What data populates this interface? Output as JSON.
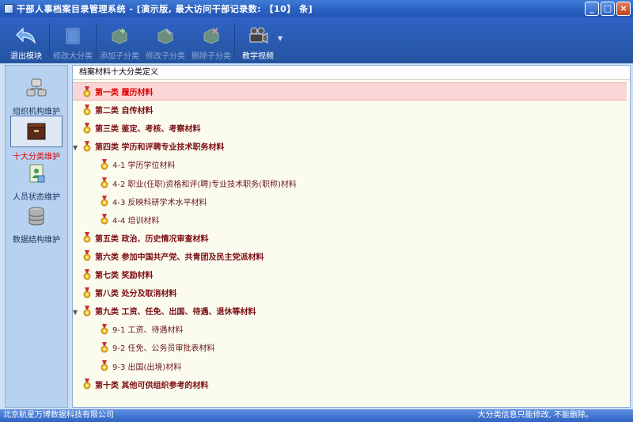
{
  "window": {
    "title": "干部人事档案目录管理系统 - [演示版, 最大访问干部记录数: 【10】 条]"
  },
  "toolbar": {
    "items": [
      {
        "label": "退出模块",
        "icon": "exit-back-arrow-icon",
        "enabled": true
      },
      {
        "label": "修改大分类",
        "icon": "book-edit-icon",
        "enabled": false
      },
      {
        "label": "添加子分类",
        "icon": "add-subcategory-icon",
        "enabled": false
      },
      {
        "label": "修改子分类",
        "icon": "edit-subcategory-icon",
        "enabled": false
      },
      {
        "label": "删除子分类",
        "icon": "delete-subcategory-icon",
        "enabled": false
      },
      {
        "label": "教学视频",
        "icon": "video-camera-icon",
        "enabled": true
      }
    ]
  },
  "leftnav": {
    "items": [
      {
        "label": "组织机构维护",
        "icon": "organization-icon",
        "active": false
      },
      {
        "label": "十大分类维护",
        "icon": "archive-box-icon",
        "active": true
      },
      {
        "label": "人员状态维护",
        "icon": "person-status-icon",
        "active": false
      },
      {
        "label": "数据结构维护",
        "icon": "database-icon",
        "active": false
      }
    ]
  },
  "panel": {
    "header": "档案材料十大分类定义",
    "rows": [
      {
        "text": "第一类  履历材料",
        "level": "top",
        "expanded": false,
        "selected": true
      },
      {
        "text": "第二类  自传材料",
        "level": "top",
        "expanded": false,
        "selected": false
      },
      {
        "text": "第三类  鉴定、考核、考察材料",
        "level": "top",
        "expanded": false,
        "selected": false
      },
      {
        "text": "第四类  学历和评聘专业技术职务材料",
        "level": "top",
        "expanded": true,
        "selected": false
      },
      {
        "text": "4-1  学历学位材料",
        "level": "sub",
        "selected": false
      },
      {
        "text": "4-2  职业(任职)资格和评(聘)专业技术职务(职称)材料",
        "level": "sub",
        "selected": false
      },
      {
        "text": "4-3  反映科研学术水平材料",
        "level": "sub",
        "selected": false
      },
      {
        "text": "4-4  培训材料",
        "level": "sub",
        "selected": false
      },
      {
        "text": "第五类  政治、历史情况审查材料",
        "level": "top",
        "expanded": false,
        "selected": false
      },
      {
        "text": "第六类  参加中国共产党、共青团及民主党派材料",
        "level": "top",
        "expanded": false,
        "selected": false
      },
      {
        "text": "第七类  奖励材料",
        "level": "top",
        "expanded": false,
        "selected": false
      },
      {
        "text": "第八类  处分及取消材料",
        "level": "top",
        "expanded": false,
        "selected": false
      },
      {
        "text": "第九类  工资、任免、出国、待遇、退休等材料",
        "level": "top",
        "expanded": true,
        "selected": false
      },
      {
        "text": "9-1  工资、待遇材料",
        "level": "sub",
        "selected": false
      },
      {
        "text": "9-2  任免、公务员审批表材料",
        "level": "sub",
        "selected": false
      },
      {
        "text": "9-3  出国(出境)材料",
        "level": "sub",
        "selected": false
      },
      {
        "text": "第十类  其他可供组织参考的材料",
        "level": "top",
        "expanded": false,
        "selected": false
      }
    ]
  },
  "statusbar": {
    "company": "北京航星万博数据科技有限公司",
    "message": "大分类信息只能修改, 不能删除。"
  },
  "colors": {
    "titlebar": "#2a5fc0",
    "toolbar": "#2f63c4",
    "panel_bg": "#fbfbee",
    "selected_row": "#fad6d6",
    "category_text": "#7a0c12",
    "selected_text": "#e00000"
  }
}
